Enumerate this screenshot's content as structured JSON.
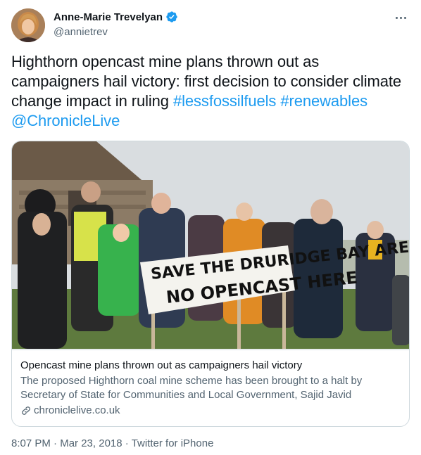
{
  "author": {
    "display_name": "Anne-Marie Trevelyan",
    "handle": "@annietrev",
    "verified_icon": "verified-badge-icon"
  },
  "tweet": {
    "text_plain": "Highthorn opencast mine plans thrown out as campaigners hail victory: first decision to consider climate change impact in ruling",
    "hashtag_1": "#lessfossilfuels",
    "hashtag_2": "#renewables",
    "mention": "@ChronicleLive"
  },
  "card": {
    "banner_line1": "SAVE THE DRURIDGE BAY AREA",
    "banner_line2": "NO OPENCAST HERE",
    "title": "Opencast mine plans thrown out as campaigners hail victory",
    "description": "The proposed Highthorn coal mine scheme has been brought to a halt by Secretary of State for Communities and Local Government, Sajid Javid",
    "domain": "chroniclelive.co.uk",
    "domain_icon": "link-icon"
  },
  "meta": {
    "time": "8:07 PM",
    "date": "Mar 23, 2018",
    "separator": "·",
    "source": "Twitter for iPhone"
  },
  "colors": {
    "accent": "#1d9bf0",
    "text": "#0f1419",
    "secondary": "#536471",
    "border": "#cfd9de"
  }
}
